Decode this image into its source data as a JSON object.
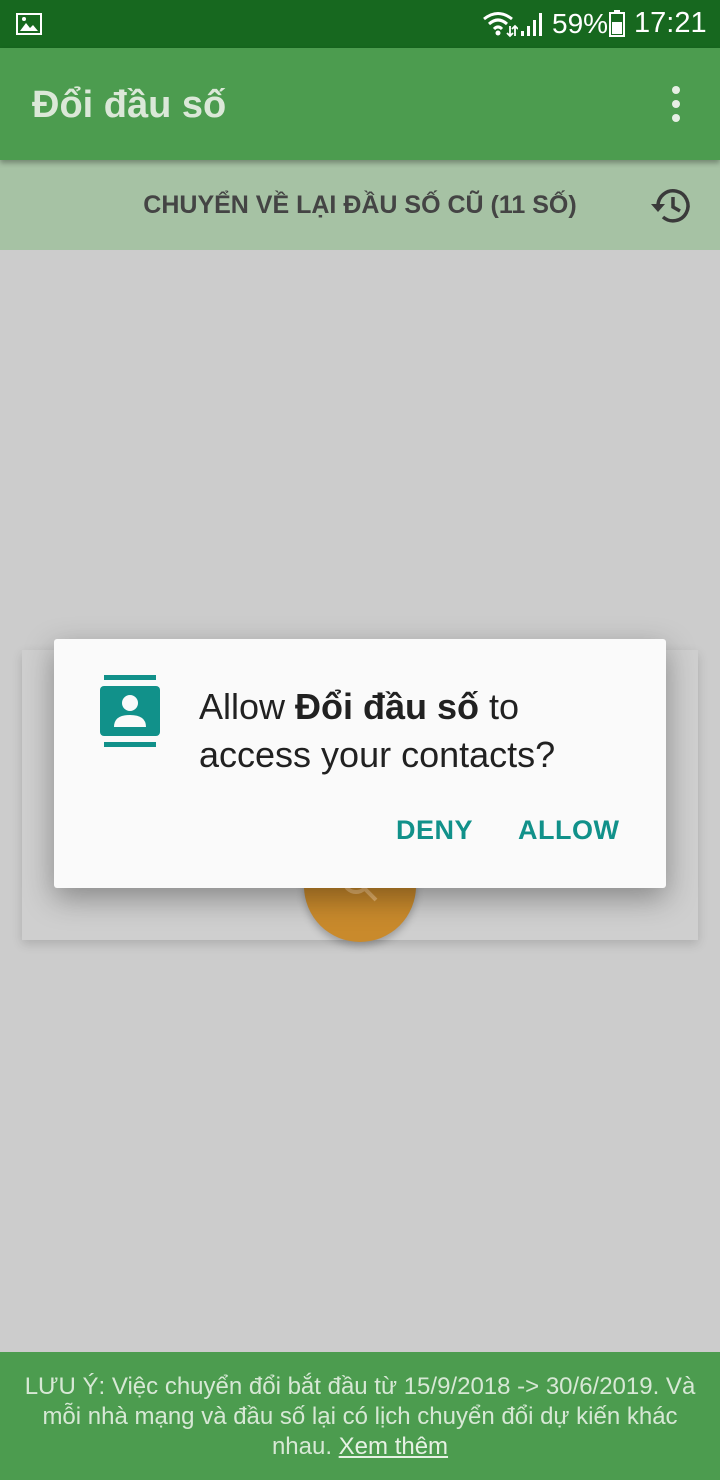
{
  "status_bar": {
    "battery_percent": "59%",
    "time": "17:21",
    "icons": [
      "gallery-icon",
      "wifi-icon",
      "signal-icon",
      "battery-icon"
    ]
  },
  "app_bar": {
    "title": "Đổi đầu số",
    "menu_icon": "more-vert-icon"
  },
  "sub_bar": {
    "label": "CHUYỂN VỀ LẠI ĐẦU SỐ CŨ (11 SỐ)",
    "icon": "history-icon"
  },
  "dialog": {
    "icon": "contacts-icon",
    "message_prefix": "Allow ",
    "app_name": "Đổi đầu số",
    "message_suffix": " to access your contacts?",
    "deny_label": "DENY",
    "allow_label": "ALLOW"
  },
  "footer": {
    "notice": "LƯU Ý: Việc chuyển đổi bắt đầu từ 15/9/2018 -> 30/6/2019. Và mỗi nhà mạng và đầu số lại có lịch chuyển đổi dự kiến khác nhau. ",
    "link_label": "Xem thêm"
  },
  "colors": {
    "status_bar": "#17681f",
    "app_bar": "#4c9c4f",
    "sub_bar": "#a6c2a4",
    "accent": "#11918a",
    "fab": "#c98a2c"
  }
}
